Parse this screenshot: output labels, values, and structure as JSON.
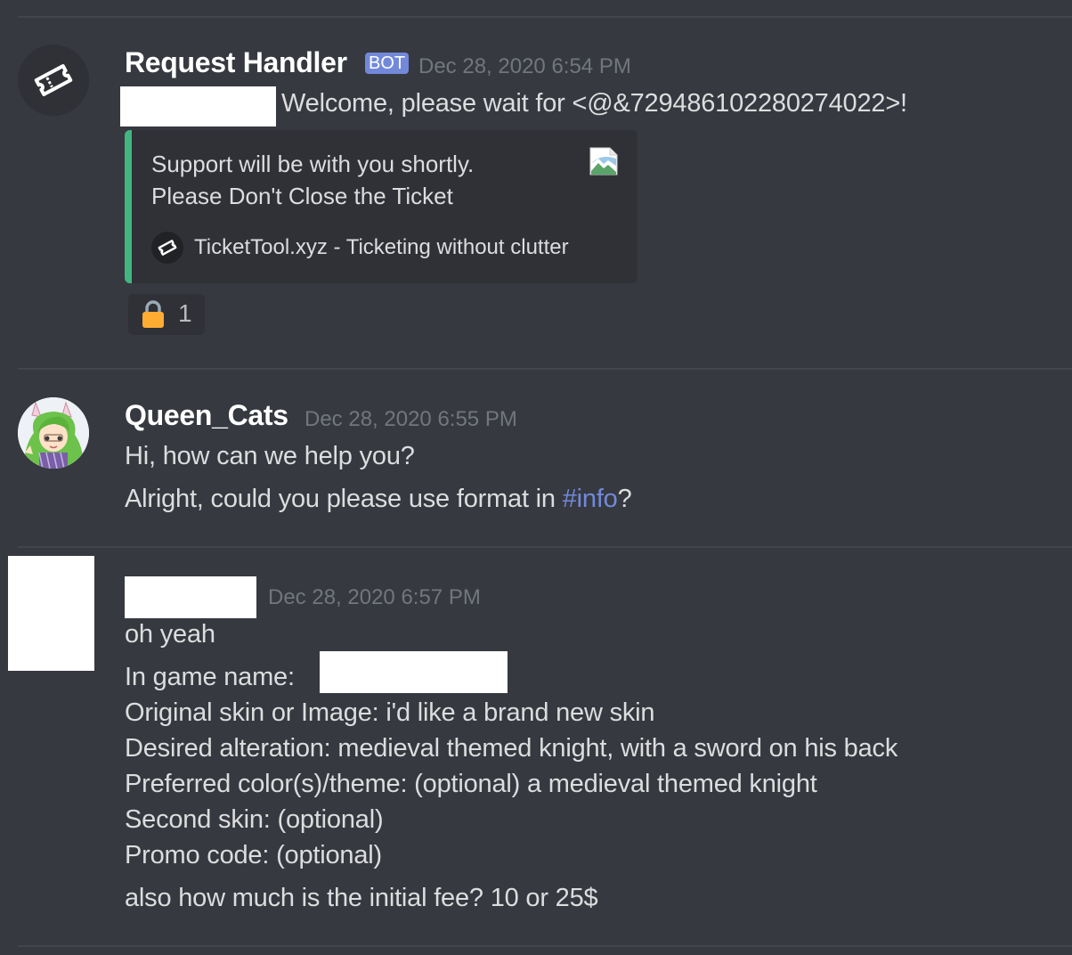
{
  "messages": [
    {
      "author": "Request Handler",
      "badge": "BOT",
      "timestamp": "Dec 28, 2020 6:54 PM",
      "avatar_icon": "ticket-icon",
      "lines": [
        "Welcome, please wait for <@&729486102280274022>!"
      ],
      "embed": {
        "description_line1": "Support will be with you shortly.",
        "description_line2": "Please Don't Close the Ticket",
        "footer_icon": "ticket-icon",
        "footer_text": "TicketTool.xyz - Ticketing without clutter",
        "accent_color": "#43b581",
        "thumbnail_icon": "broken-image-icon"
      },
      "reaction": {
        "emoji": "lock-icon",
        "count": "1"
      }
    },
    {
      "author": "Queen_Cats",
      "timestamp": "Dec 28, 2020 6:55 PM",
      "avatar_icon": "anime-girl-avatar",
      "lines": [
        "Hi, how can we help you?"
      ],
      "line2_prefix": "Alright, could you please use format in ",
      "line2_channel": "#info",
      "line2_suffix": "?"
    },
    {
      "timestamp": "Dec 28, 2020 6:57 PM",
      "lines": [
        "oh yeah",
        "In game name:",
        "Original skin or Image: i'd like a brand new skin",
        "Desired alteration: medieval themed knight, with a sword on his back",
        "Preferred color(s)/theme: (optional) a medieval themed knight",
        "Second skin: (optional)",
        "Promo code: (optional)",
        "also how much is the initial fee? 10 or 25$"
      ]
    }
  ],
  "colors": {
    "background": "#36393f",
    "mention": "#7289da",
    "bot_badge": "#7289da",
    "timestamp": "#72767d",
    "embed_bg": "#2f3136"
  }
}
